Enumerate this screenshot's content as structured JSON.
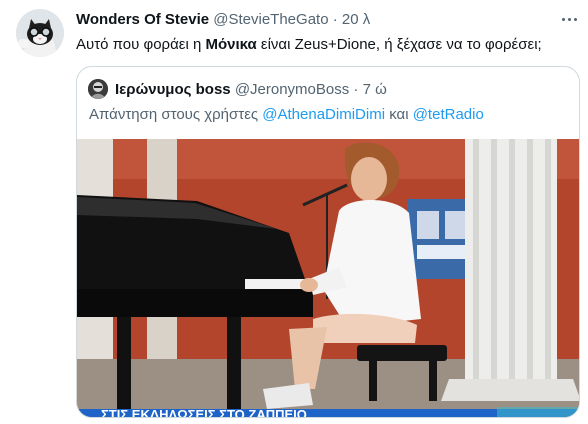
{
  "tweet": {
    "author_name": "Wonders Of Stevie",
    "author_handle": "@StevieTheGato",
    "separator": "·",
    "time": "20 λ",
    "text_before": "Αυτό που φοράει η ",
    "text_bold": "Μόνικα",
    "text_after": " είναι Zeus+Dione, ή ξέχασε να το φορέσει;",
    "avatar_icon": "cat-avatar-icon",
    "more_icon": "more-options-icon"
  },
  "quoted": {
    "author_name": "Ιερώνυμος boss",
    "author_handle": "@JeronymoBoss",
    "separator": "·",
    "time": "7 ώ",
    "reply_prefix": "Απάντηση στους χρήστες ",
    "mention_1": "@AthenaDimiDimi",
    "reply_join": " και ",
    "mention_2": "@tetRadio",
    "media_caption": "ΣΤΙΣ ΕΚΔΗΛΩΣΕΙΣ ΣΤΟ ΖΑΠΠΕΙΟ",
    "avatar_icon": "boss-avatar-icon"
  },
  "colors": {
    "link": "#1d9bf0",
    "secondary_text": "#536471",
    "border": "#cfd9de",
    "caption_banner": "#1d63c8"
  }
}
